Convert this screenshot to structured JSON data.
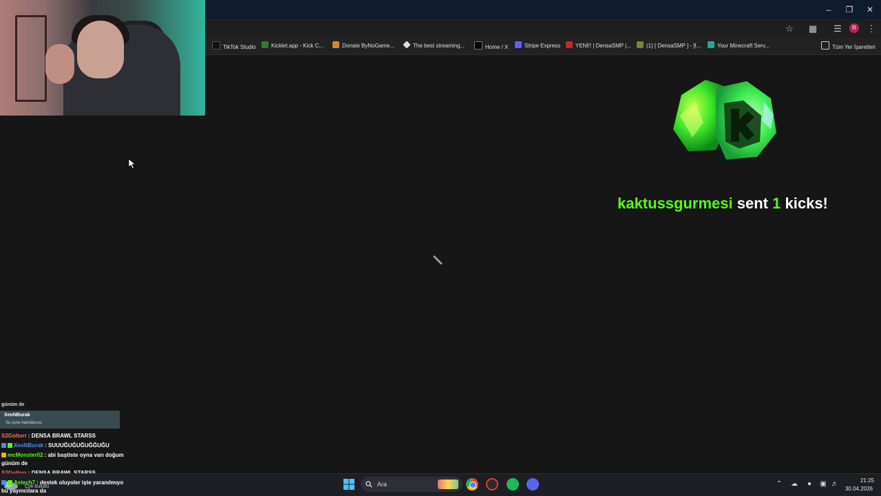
{
  "bookmarks": [
    {
      "label": "TikTok Studio",
      "color": "#111111"
    },
    {
      "label": "Kicklet.app - Kick C...",
      "color": "#2e7d32"
    },
    {
      "label": "Donate ByNoGame...",
      "color": "#d08a2a"
    },
    {
      "label": "The best streaming...",
      "color": "#dddddd"
    },
    {
      "label": "Home / X",
      "color": "#000000"
    },
    {
      "label": "Stripe Express",
      "color": "#635bff"
    },
    {
      "label": "YENİ!! | DensaSMP |...",
      "color": "#c62828"
    },
    {
      "label": "(1) [ DensaSMP ] - [I...",
      "color": "#6d8b3a"
    },
    {
      "label": "Your Minecraft Serv...",
      "color": "#26a69a"
    }
  ],
  "bookmarks_all": "Tüm Yer İşaretleri",
  "profile_initial": "R",
  "alert": {
    "user": "kaktussgurmesi",
    "sent": "sent",
    "count": "1",
    "unit": "kicks!"
  },
  "chat": {
    "top_fragment": "günüm de",
    "highlight_name": "XeoNBurak",
    "highlight_sub": "Su içme hatırlatıcısı",
    "messages": [
      {
        "user": "S2Goltorr",
        "user_color": "#ff6b6b",
        "text": ": DENSA BRAWL STARSS"
      },
      {
        "user": "XeoNBurak",
        "user_color": "#4a90e2",
        "text": ": SUUUĞUĞUĞUĞĞUĞU"
      },
      {
        "user": "mcMonster02",
        "user_color": "#53fc18",
        "text": ": abi baştiste oyna varı doğum"
      },
      {
        "user": "S2Goltorr",
        "user_color": "#ff6b6b",
        "text": ": DENSA BRAWL STARSS"
      },
      {
        "user": "Astech7",
        "user_color": "#53fc18",
        "text": ": destek oluyoler işte yaranılmıyo"
      }
    ],
    "continuation_1": "günüm de",
    "continuation_2": "bu yayıncılara da"
  },
  "taskbar": {
    "weather": "Çok bulutlu",
    "search_placeholder": "Ara",
    "time": "21:25",
    "date": "30.04.2026"
  },
  "colors": {
    "kick_green": "#53fc18",
    "title_bar": "#0f1b2f",
    "stage_bg": "#161616"
  }
}
